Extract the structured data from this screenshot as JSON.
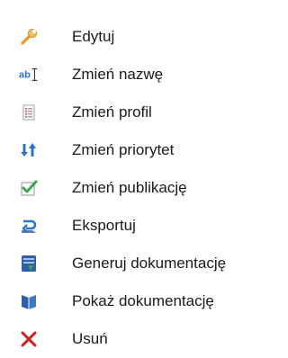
{
  "menu": {
    "items": [
      {
        "label": "Edytuj",
        "icon": "wrench-icon"
      },
      {
        "label": "Zmień nazwę",
        "icon": "rename-icon",
        "icon_text": "ab"
      },
      {
        "label": "Zmień profil",
        "icon": "profile-document-icon"
      },
      {
        "label": "Zmień priorytet",
        "icon": "priority-arrows-icon"
      },
      {
        "label": "Zmień publikację",
        "icon": "publish-checkmark-icon"
      },
      {
        "label": "Eksportuj",
        "icon": "export-arrow-icon"
      },
      {
        "label": "Generuj dokumentację",
        "icon": "generate-documentation-icon"
      },
      {
        "label": "Pokaż dokumentację",
        "icon": "book-icon"
      },
      {
        "label": "Usuń",
        "icon": "delete-x-icon"
      }
    ]
  },
  "colors": {
    "text": "#1a1a1a",
    "delete": "#d21f1f",
    "accent_blue": "#2f73c8",
    "accent_green": "#3aa84a",
    "wrench": "#f0b24a"
  }
}
